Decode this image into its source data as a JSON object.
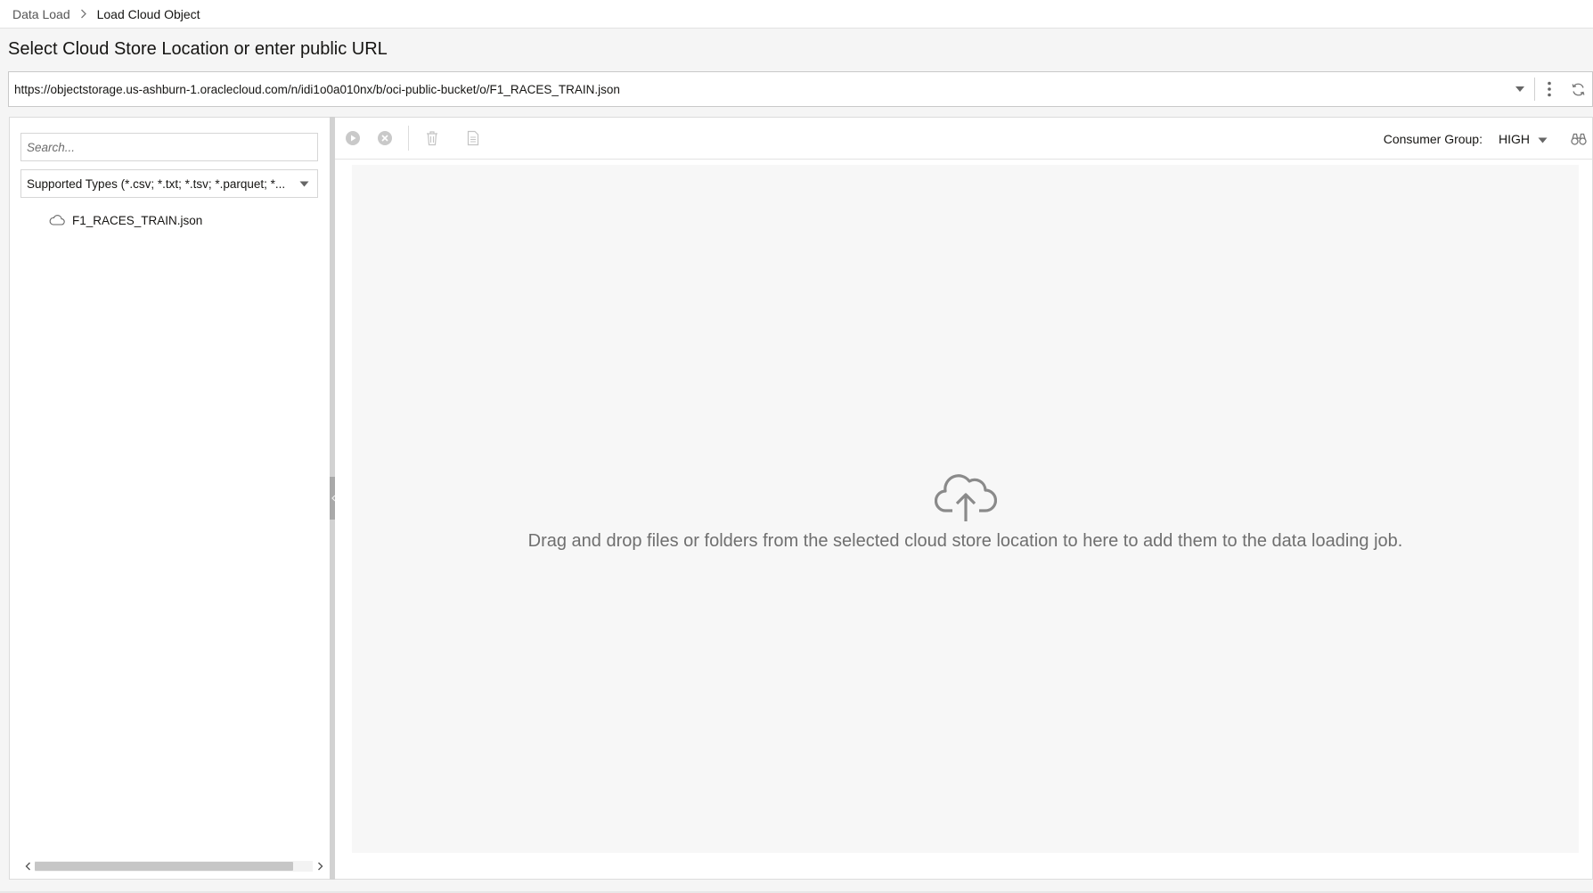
{
  "breadcrumb": {
    "parent": "Data Load",
    "current": "Load Cloud Object"
  },
  "page": {
    "title": "Select Cloud Store Location or enter public URL"
  },
  "url_bar": {
    "value": "https://objectstorage.us-ashburn-1.oraclecloud.com/n/idi1o0a010nx/b/oci-public-bucket/o/F1_RACES_TRAIN.json"
  },
  "left_panel": {
    "search_placeholder": "Search...",
    "filter_selected": "Supported Types (*.csv; *.txt; *.tsv; *.parquet; *...",
    "items": [
      {
        "label": "F1_RACES_TRAIN.json",
        "icon": "cloud-icon"
      }
    ]
  },
  "toolbar": {
    "consumer_group_label": "Consumer Group:",
    "consumer_group_value": "HIGH"
  },
  "dropzone": {
    "message": "Drag and drop files or folders from the selected cloud store location to here to add them to the data loading job.",
    "icon": "cloud-upload-icon"
  },
  "colors": {
    "icon_gray": "#9a9a9a",
    "text_muted": "#6f6f6f",
    "dropzone_bg": "#f7f7f7"
  }
}
